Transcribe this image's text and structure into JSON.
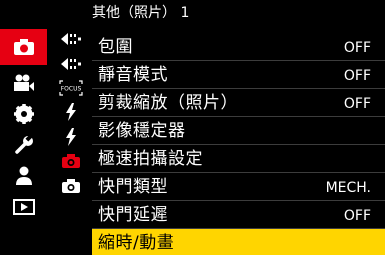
{
  "header": {
    "title": "其他（照片） 1"
  },
  "categories": [
    {
      "icon": "camera-icon",
      "selected": true
    },
    {
      "icon": "video-camera-icon"
    },
    {
      "icon": "gear-icon"
    },
    {
      "icon": "wrench-icon"
    },
    {
      "icon": "person-icon"
    },
    {
      "icon": "playback-icon"
    }
  ],
  "sub_icons": [
    "transition-arrow-icon",
    "transition-arrow-icon",
    "focus-icon",
    "lightning-icon",
    "lightning-icon",
    "camera-icon-active",
    "camera-icon"
  ],
  "menu": {
    "items": [
      {
        "label": "包圍",
        "value": "OFF"
      },
      {
        "label": "靜音模式",
        "value": "OFF"
      },
      {
        "label": "剪裁縮放（照片）",
        "value": "OFF"
      },
      {
        "label": "影像穩定器",
        "value": ""
      },
      {
        "label": "極速拍攝設定",
        "value": ""
      },
      {
        "label": "快門類型",
        "value": "MECH."
      },
      {
        "label": "快門延遲",
        "value": "OFF"
      },
      {
        "label": "縮時/動畫",
        "value": "",
        "selected": true
      }
    ]
  },
  "colors": {
    "accent": "#e60012",
    "highlight": "#ffd500",
    "background": "#000000"
  },
  "icon_text": {
    "focus": "FOCUS"
  }
}
